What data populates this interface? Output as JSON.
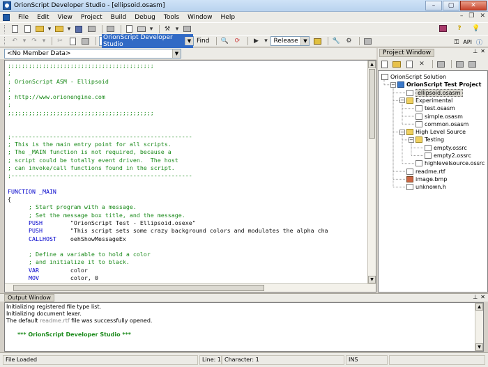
{
  "window": {
    "title": "OrionScript Developer Studio - [ellipsoid.osasm]"
  },
  "menu": [
    "File",
    "Edit",
    "View",
    "Project",
    "Build",
    "Debug",
    "Tools",
    "Window",
    "Help"
  ],
  "toolbar": {
    "search_combo": "OrionScript Developer Studio",
    "find_label": "Find",
    "config_combo": "Release",
    "api_label": "API"
  },
  "member_combo": "<No Member Data>",
  "editor": {
    "file": "ellipsoid.osasm",
    "lines": [
      {
        "t": "c",
        "text": ";;;;;;;;;;;;;;;;;;;;;;;;;;;;;;;;;;;;;;;;;;"
      },
      {
        "t": "c",
        "text": ";"
      },
      {
        "t": "c",
        "text": "; OrionScript ASM - Ellipsoid"
      },
      {
        "t": "c",
        "text": ";"
      },
      {
        "t": "c",
        "text": "; http://www.orionengine.com"
      },
      {
        "t": "c",
        "text": ";"
      },
      {
        "t": "c",
        "text": ";;;;;;;;;;;;;;;;;;;;;;;;;;;;;;;;;;;;;;;;;;"
      },
      {
        "t": "s",
        "text": ""
      },
      {
        "t": "s",
        "text": ""
      },
      {
        "t": "c",
        "text": ";----------------------------------------------------"
      },
      {
        "t": "c",
        "text": "; This is the main entry point for all scripts."
      },
      {
        "t": "c",
        "text": "; The _MAIN function is not required, because a"
      },
      {
        "t": "c",
        "text": "; script could be totally event driven.  The host"
      },
      {
        "t": "c",
        "text": "; can invoke/call functions found in the script."
      },
      {
        "t": "c",
        "text": ";----------------------------------------------------"
      },
      {
        "t": "s",
        "text": ""
      },
      {
        "t": "k",
        "text": "FUNCTION _MAIN"
      },
      {
        "t": "s",
        "text": "{"
      },
      {
        "t": "c",
        "text": "      ; Start program with a message."
      },
      {
        "t": "c",
        "text": "      ; Set the message box title, and the message."
      },
      {
        "t": "ks",
        "k": "      PUSH",
        "text": "        \"OrionScript Test - Ellipsoid.osexe\""
      },
      {
        "t": "ks",
        "k": "      PUSH",
        "text": "        \"This script sets some crazy background colors and modulates the alpha cha"
      },
      {
        "t": "ks",
        "k": "      CALLHOST",
        "text": "    oehShowMessageEx"
      },
      {
        "t": "s",
        "text": ""
      },
      {
        "t": "c",
        "text": "      ; Define a variable to hold a color"
      },
      {
        "t": "c",
        "text": "      ; and initialize it to black."
      },
      {
        "t": "ks",
        "k": "      VAR",
        "text": "         color"
      },
      {
        "t": "ks",
        "k": "      MOV",
        "text": "         color, 0"
      }
    ]
  },
  "project": {
    "title": "Project Window",
    "nodes": [
      {
        "label": "OrionScript Solution",
        "depth": 0,
        "icon": "sol",
        "exp": ""
      },
      {
        "label": "OrionScript Test Project",
        "depth": 1,
        "icon": "proj",
        "exp": "-",
        "bold": true
      },
      {
        "label": "ellipsoid.osasm",
        "depth": 2,
        "icon": "file",
        "exp": "",
        "selected": true
      },
      {
        "label": "Experimental",
        "depth": 2,
        "icon": "folder",
        "exp": "-"
      },
      {
        "label": "test.osasm",
        "depth": 3,
        "icon": "file",
        "exp": ""
      },
      {
        "label": "simple.osasm",
        "depth": 3,
        "icon": "file",
        "exp": ""
      },
      {
        "label": "common.osasm",
        "depth": 3,
        "icon": "file",
        "exp": ""
      },
      {
        "label": "High Level Source",
        "depth": 2,
        "icon": "folder",
        "exp": "-"
      },
      {
        "label": "Testing",
        "depth": 3,
        "icon": "folder",
        "exp": "-"
      },
      {
        "label": "empty.ossrc",
        "depth": 4,
        "icon": "file",
        "exp": ""
      },
      {
        "label": "empty2.ossrc",
        "depth": 4,
        "icon": "file",
        "exp": ""
      },
      {
        "label": "highlevelsource.ossrc",
        "depth": 3,
        "icon": "file",
        "exp": ""
      },
      {
        "label": "readme.rtf",
        "depth": 2,
        "icon": "file",
        "exp": ""
      },
      {
        "label": "image.bmp",
        "depth": 2,
        "icon": "img",
        "exp": ""
      },
      {
        "label": "unknown.h",
        "depth": 2,
        "icon": "file",
        "exp": ""
      }
    ]
  },
  "output": {
    "title": "Output Window",
    "lines": [
      "Initializing registered file type list.",
      "Initializing document lexer."
    ],
    "line3_pre": "The default ",
    "line3_file": "readme.rtf",
    "line3_post": " file was successfully opened.",
    "banner": "*** OrionScript Developer Studio ***"
  },
  "status": {
    "message": "File Loaded",
    "line": "Line: 1",
    "character": "Character: 1",
    "mode": "INS"
  },
  "colors": {
    "comment": "#1a8a1a",
    "keyword": "#0000cc",
    "selection": "#316ac5"
  }
}
